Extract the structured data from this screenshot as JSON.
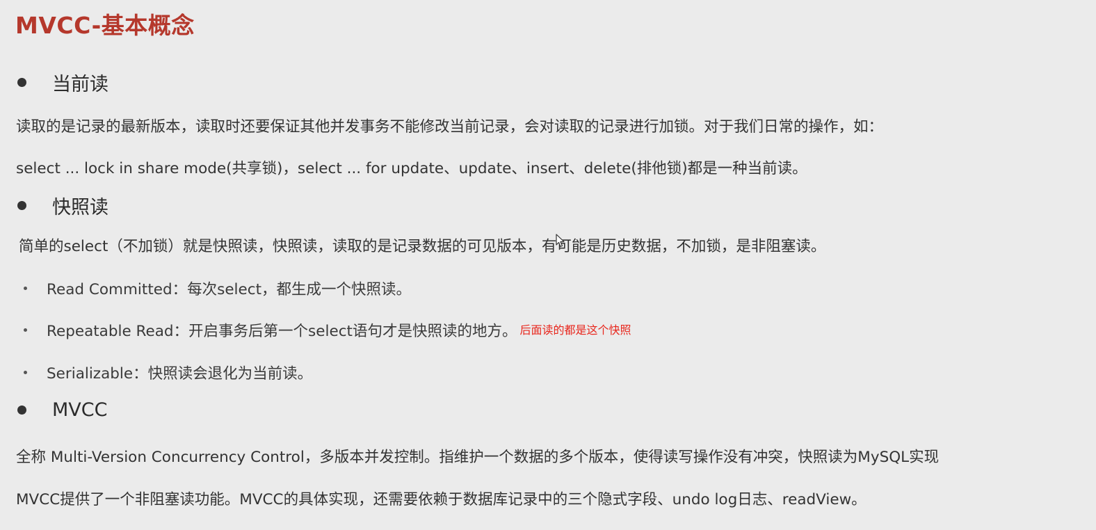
{
  "page": {
    "title": "MVCC-基本概念"
  },
  "sections": [
    {
      "heading": "当前读",
      "paragraphs": [
        "读取的是记录的最新版本，读取时还要保证其他并发事务不能修改当前记录，会对读取的记录进行加锁。对于我们日常的操作，如：",
        "select ... lock in share mode(共享锁)，select ... for update、update、insert、delete(排他锁)都是一种当前读。"
      ]
    },
    {
      "heading": "快照读",
      "paragraphs": [
        "简单的select（不加锁）就是快照读，快照读，读取的是记录数据的可见版本，有可能是历史数据，不加锁，是非阻塞读。"
      ],
      "bullets": [
        {
          "text": "Read Committed：每次select，都生成一个快照读。"
        },
        {
          "text": "Repeatable Read：开启事务后第一个select语句才是快照读的地方。",
          "note": "后面读的都是这个快照"
        },
        {
          "text": "Serializable：快照读会退化为当前读。"
        }
      ]
    },
    {
      "heading": "MVCC",
      "paragraphs": [
        "全称 Multi-Version Concurrency Control，多版本并发控制。指维护一个数据的多个版本，使得读写操作没有冲突，快照读为MySQL实现",
        "MVCC提供了一个非阻塞读功能。MVCC的具体实现，还需要依赖于数据库记录中的三个隐式字段、undo log日志、readView。"
      ]
    }
  ],
  "colors": {
    "background": "#ebebeb",
    "title": "#b5382c",
    "text": "#333333",
    "annotation": "#e8261c"
  },
  "icons": {
    "cursor": "mouse-pointer-icon"
  }
}
